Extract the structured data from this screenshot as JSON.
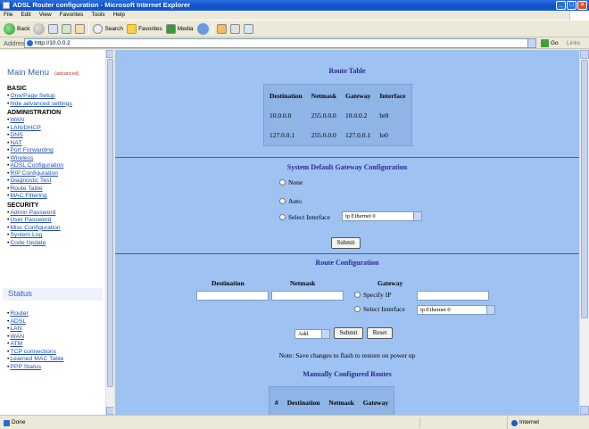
{
  "window": {
    "title": "ADSL Router configuration - Microsoft Internet Explorer"
  },
  "menubar": {
    "items": [
      "File",
      "Edit",
      "View",
      "Favorites",
      "Tools",
      "Help"
    ]
  },
  "toolbar": {
    "back": "Back",
    "search": "Search",
    "favorites": "Favorites",
    "media": "Media"
  },
  "address": {
    "label": "Address",
    "url": "http://10.0.0.2",
    "go": "Go",
    "links": "Links"
  },
  "sidebar": {
    "title": "Main Menu",
    "mode": "(advanced)",
    "sections": [
      {
        "heading": "BASIC",
        "items": [
          "One/Page Setup",
          "hide advanced settings"
        ]
      },
      {
        "heading": "ADMINISTRATION",
        "items": [
          "WAN",
          "LAN/DHCP",
          "DNS",
          "NAT",
          "Port Forwarding",
          "Wireless",
          "ADSL Configuration",
          "RIP Configuration",
          "Diagnostic Test",
          "Route Table",
          "MAC Filtering"
        ]
      },
      {
        "heading": "SECURITY",
        "items": [
          "Admin Password",
          "User Password",
          "Misc Configuration",
          "System Log",
          "Code Update"
        ]
      }
    ],
    "status_title": "Status",
    "status_items": [
      "Router",
      "ADSL",
      "LAN",
      "WAN",
      "ATM",
      "TCP connections",
      "Learned MAC Table",
      "PPP Status"
    ]
  },
  "route_table": {
    "title": "Route Table",
    "headers": [
      "Destination",
      "Netmask",
      "Gateway",
      "Interface"
    ],
    "rows": [
      [
        "10.0.0.0",
        "255.0.0.0",
        "10.0.0.2",
        "br0"
      ],
      [
        "127.0.0.1",
        "255.0.0.0",
        "127.0.0.1",
        "lo0"
      ]
    ]
  },
  "default_gateway": {
    "title": "System Default Gateway Configuration",
    "opt_none": "None",
    "opt_auto": "Auto",
    "opt_select": "Select Interface",
    "iface_value": "ip Ethernet 0",
    "submit": "Submit"
  },
  "route_config": {
    "title": "Route Configuration",
    "col_destination": "Destination",
    "col_netmask": "Netmask",
    "col_gateway": "Gateway",
    "opt_specify_ip": "Specify IP",
    "opt_select_iface": "Select Interface",
    "iface_value": "ip Ethernet 0",
    "action_value": "Add",
    "submit": "Submit",
    "reset": "Reset",
    "note": "Note: Save changes to flash to restore on power up"
  },
  "manual_routes": {
    "title": "Manually Configured Routes",
    "headers": [
      "#",
      "Destination",
      "Netmask",
      "Gateway"
    ]
  },
  "statusbar": {
    "left": "Done",
    "zone": "Internet"
  }
}
